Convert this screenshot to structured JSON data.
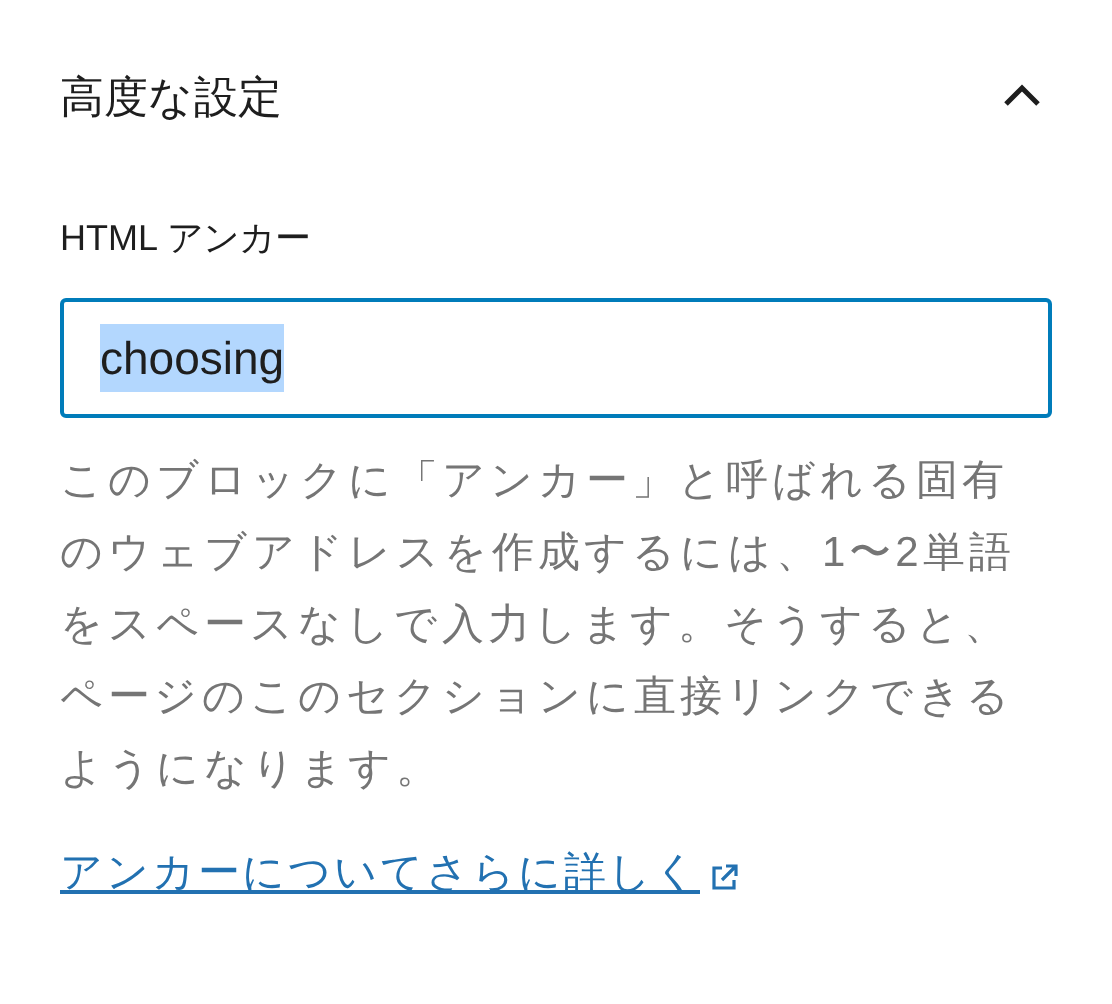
{
  "panel": {
    "title": "高度な設定",
    "expanded": true
  },
  "field": {
    "label": "HTML アンカー",
    "value": "choosing",
    "focused": true,
    "value_selected": true
  },
  "help_text": "このブロックに「アンカー」と呼ばれる固有のウェブアドレスを作成するには、1〜2単語をスペースなしで入力します。そうすると、ページのこのセクションに直接リンクできるようになります。",
  "link": {
    "text": "アンカーについてさらに詳しく",
    "external": true
  }
}
